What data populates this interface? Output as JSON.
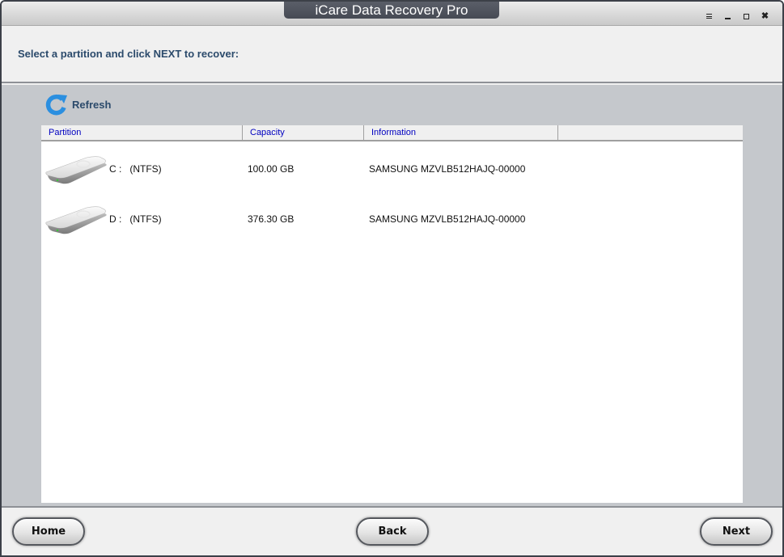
{
  "window": {
    "title": "iCare Data Recovery Pro",
    "controls": [
      "menu-icon",
      "minimize-icon",
      "maximize-icon",
      "close-icon"
    ]
  },
  "header": {
    "instruction": "Select a partition and click NEXT to recover:"
  },
  "toolbar": {
    "refresh_label": "Refresh",
    "refresh_icon": "refresh-icon"
  },
  "table": {
    "columns": [
      "Partition",
      "Capacity",
      "Information",
      ""
    ],
    "rows": [
      {
        "icon": "hard-drive-icon",
        "drive": "C :",
        "filesystem": "(NTFS)",
        "capacity": "100.00 GB",
        "information": "SAMSUNG MZVLB512HAJQ-00000"
      },
      {
        "icon": "hard-drive-icon",
        "drive": "D :",
        "filesystem": "(NTFS)",
        "capacity": "376.30 GB",
        "information": "SAMSUNG MZVLB512HAJQ-00000"
      }
    ]
  },
  "footer": {
    "home_label": "Home",
    "back_label": "Back",
    "next_label": "Next"
  },
  "colors": {
    "title_tab_bg": "#4f535d",
    "instruction_text": "#2b4a6b",
    "header_text": "#0000c0",
    "panel_bg": "#c5c8cc",
    "refresh_icon": "#2b8fe0"
  }
}
